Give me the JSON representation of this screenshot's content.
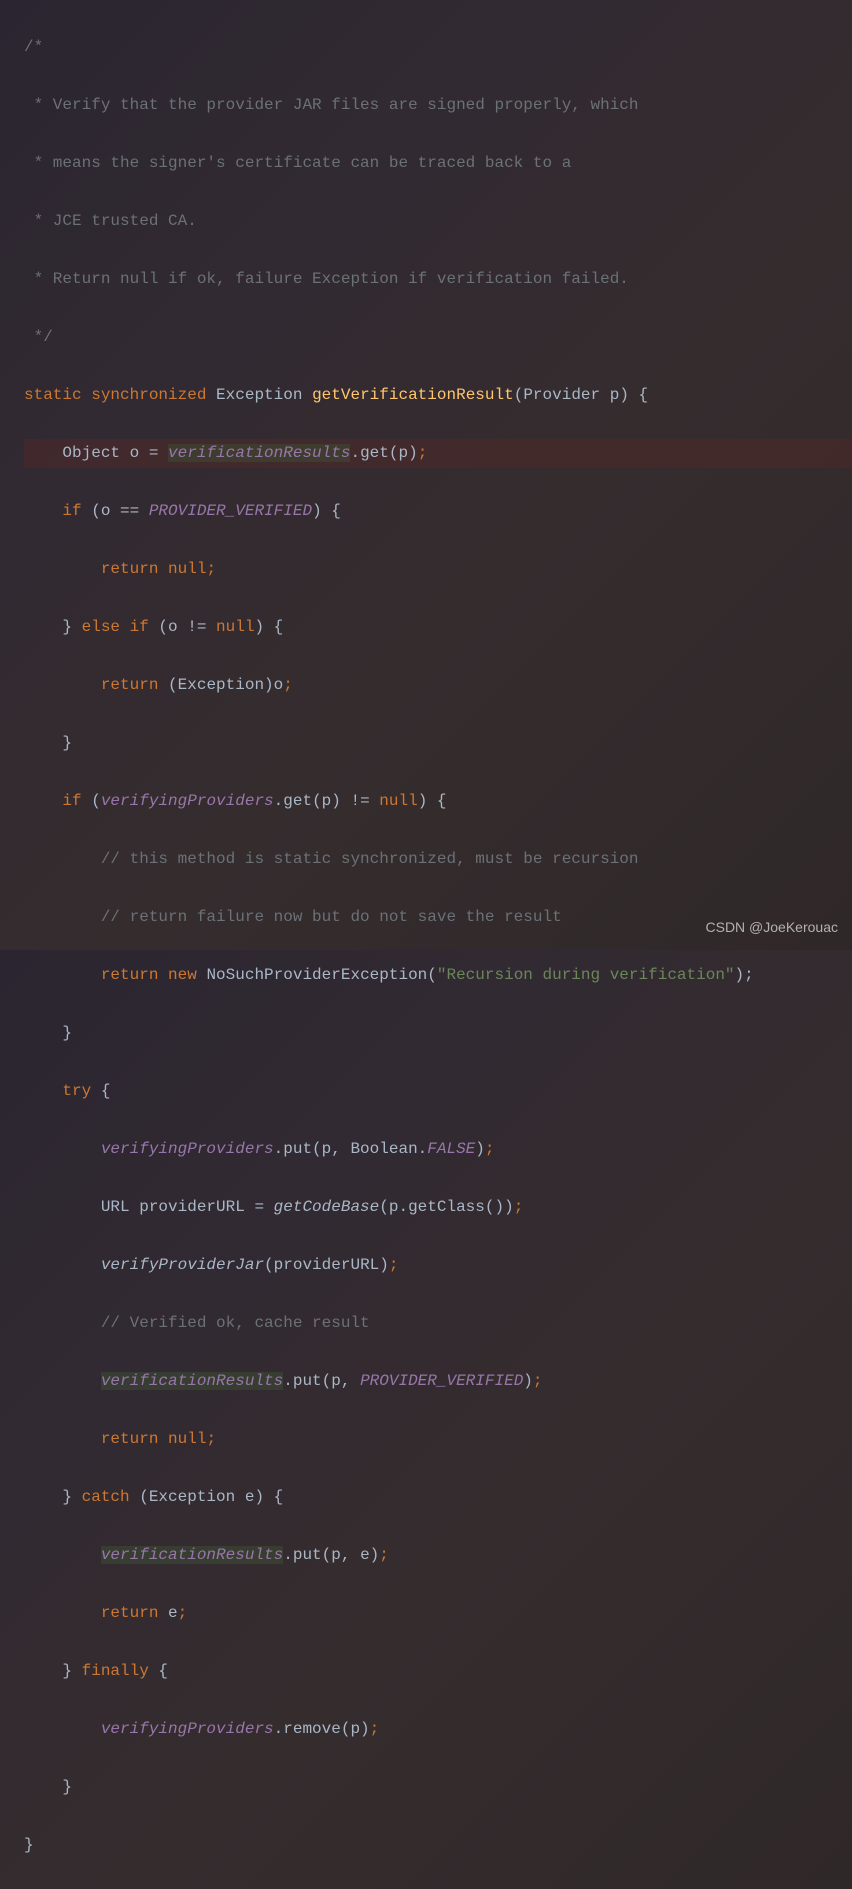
{
  "watermark": "CSDN @JoeKerouac",
  "code": {
    "c1": "/*",
    "c2": " * Verify that the provider JAR files are signed properly, which",
    "c3": " * means the signer's certificate can be traced back to a",
    "c4": " * JCE trusted CA.",
    "c5": " * Return null if ok, failure Exception if verification failed.",
    "c6": " */",
    "kw_static": "static ",
    "kw_synchronized": "synchronized ",
    "type_exception": "Exception ",
    "method_name": "getVerificationResult",
    "paren_open": "(",
    "param_type": "Provider ",
    "param_name": "p",
    "paren_close_brace": ") {",
    "l8_indent": "    ",
    "l8_object": "Object o = ",
    "l8_field": "verificationResults",
    "l8_call": ".get(p)",
    "l8_semi": ";",
    "l9_indent": "    ",
    "l9_if": "if ",
    "l9_cond1": "(o == ",
    "l9_const": "PROVIDER_VERIFIED",
    "l9_cond2": ") {",
    "l10_indent": "        ",
    "l10_return": "return null",
    "l10_semi": ";",
    "l11_indent": "    } ",
    "l11_else": "else if ",
    "l11_cond": "(o != ",
    "l11_null": "null",
    "l11_close": ") {",
    "l12_indent": "        ",
    "l12_return": "return ",
    "l12_cast": "(Exception)o",
    "l12_semi": ";",
    "l13_close": "    }",
    "l14_indent": "    ",
    "l14_if": "if ",
    "l14_open": "(",
    "l14_field": "verifyingProviders",
    "l14_call": ".get(p) != ",
    "l14_null": "null",
    "l14_close": ") {",
    "l15": "        // this method is static synchronized, must be recursion",
    "l16": "        // return failure now but do not save the result",
    "l17_indent": "        ",
    "l17_return": "return new ",
    "l17_type": "NoSuchProviderException(",
    "l17_string": "\"Recursion during verification\"",
    "l17_close": ");",
    "l18_close": "    }",
    "l19_indent": "    ",
    "l19_try": "try ",
    "l19_brace": "{",
    "l20_indent": "        ",
    "l20_field": "verifyingProviders",
    "l20_call": ".put(p, Boolean.",
    "l20_const": "FALSE",
    "l20_close": ")",
    "l20_semi": ";",
    "l21_indent": "        ",
    "l21_decl": "URL providerURL = ",
    "l21_method": "getCodeBase",
    "l21_args": "(p.getClass())",
    "l21_semi": ";",
    "l22_indent": "        ",
    "l22_method": "verifyProviderJar",
    "l22_args": "(providerURL)",
    "l22_semi": ";",
    "l23": "        // Verified ok, cache result",
    "l24_indent": "        ",
    "l24_field": "verificationResults",
    "l24_call": ".put(p, ",
    "l24_const": "PROVIDER_VERIFIED",
    "l24_close": ")",
    "l24_semi": ";",
    "l25_indent": "        ",
    "l25_return": "return null",
    "l25_semi": ";",
    "l26_indent": "    } ",
    "l26_catch": "catch ",
    "l26_params": "(Exception e) {",
    "l27_indent": "        ",
    "l27_field": "verificationResults",
    "l27_call": ".put(p, e)",
    "l27_semi": ";",
    "l28_indent": "        ",
    "l28_return": "return ",
    "l28_var": "e",
    "l28_semi": ";",
    "l29_indent": "    } ",
    "l29_finally": "finally ",
    "l29_brace": "{",
    "l30_indent": "        ",
    "l30_field": "verifyingProviders",
    "l30_call": ".remove(p)",
    "l30_semi": ";",
    "l31_close": "    }",
    "l32_close": "}"
  }
}
